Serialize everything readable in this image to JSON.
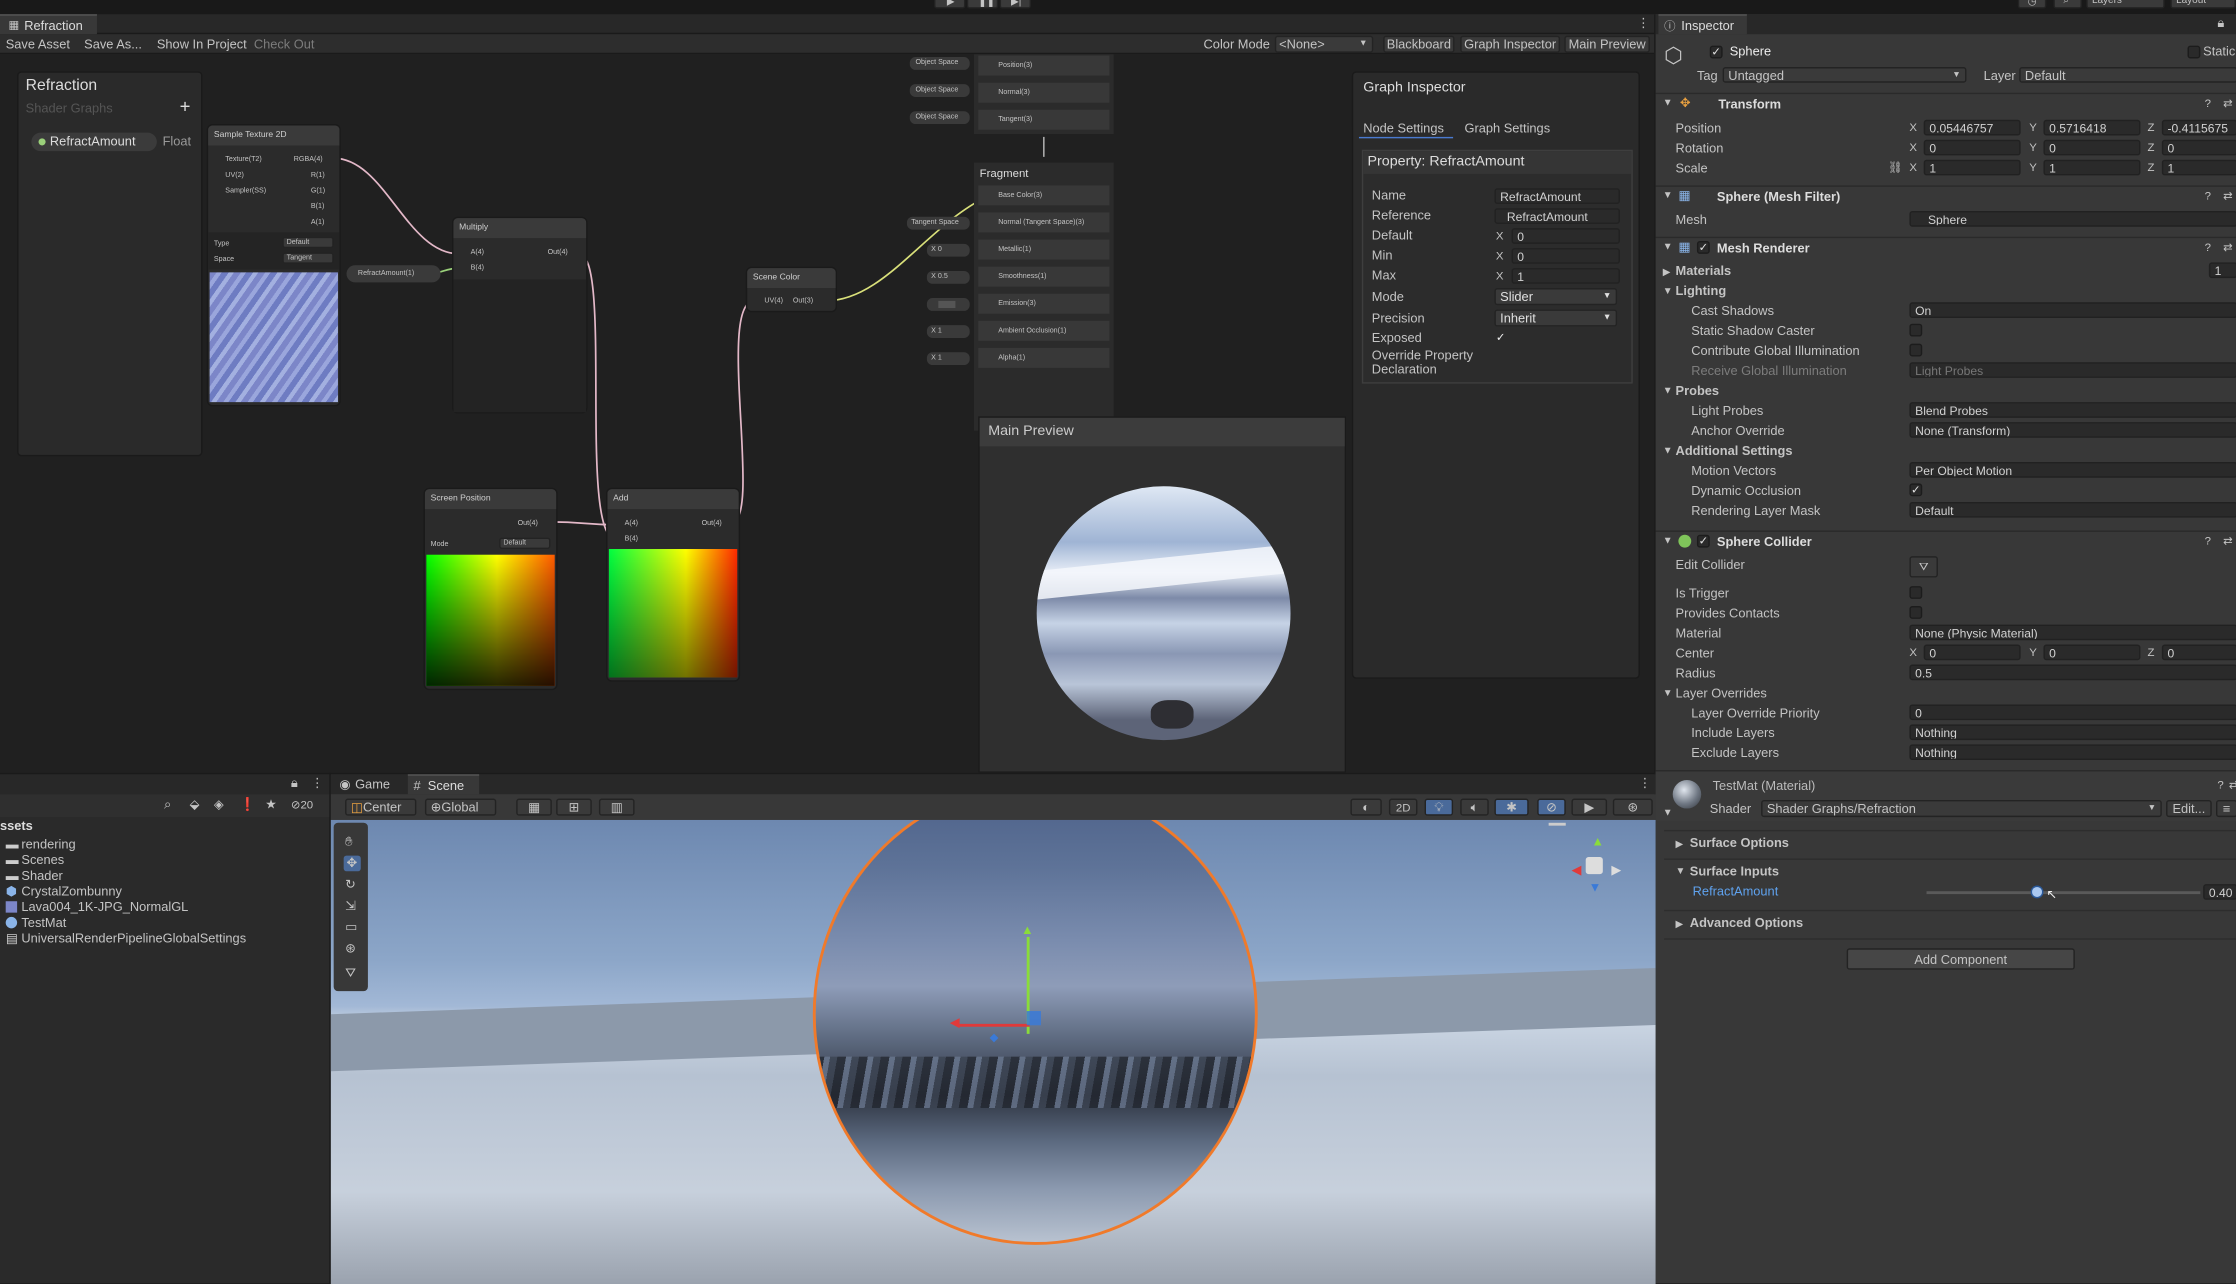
{
  "shader_graph": {
    "window_title": "Refraction",
    "toolbar": {
      "save_asset": "Save Asset",
      "save_as": "Save As...",
      "show_in_project": "Show In Project",
      "check_out": "Check Out",
      "color_mode_label": "Color Mode",
      "color_mode_value": "<None>",
      "blackboard": "Blackboard",
      "graph_inspector": "Graph Inspector",
      "main_preview": "Main Preview"
    },
    "blackboard": {
      "title": "Refraction",
      "subtitle": "Shader Graphs",
      "property_name": "RefractAmount",
      "property_type": "Float"
    },
    "nodes": {
      "sample_texture": {
        "title": "Sample Texture 2D",
        "in_texture": "Texture(T2)",
        "in_uv": "UV(2)",
        "in_sampler": "Sampler(SS)",
        "out_rgba": "RGBA(4)",
        "out_r": "R(1)",
        "out_g": "G(1)",
        "out_b": "B(1)",
        "out_a": "A(1)",
        "type_label": "Type",
        "type_value": "Default",
        "space_label": "Space",
        "space_value": "Tangent"
      },
      "refract_prop": {
        "label": "RefractAmount(1)"
      },
      "multiply": {
        "title": "Multiply",
        "in_a": "A(4)",
        "in_b": "B(4)",
        "out": "Out(4)"
      },
      "scene_color": {
        "title": "Scene Color",
        "in_uv": "UV(4)",
        "out": "Out(3)"
      },
      "screen_position": {
        "title": "Screen Position",
        "out": "Out(4)",
        "mode_label": "Mode",
        "mode_value": "Default"
      },
      "add": {
        "title": "Add",
        "in_a": "A(4)",
        "in_b": "B(4)",
        "out": "Out(4)"
      },
      "vertex": {
        "pos_space": "Object Space",
        "norm_space": "Object Space",
        "tan_space": "Object Space",
        "position": "Position(3)",
        "normal": "Normal(3)",
        "tangent": "Tangent(3)"
      },
      "fragment": {
        "title": "Fragment",
        "base_color": "Base Color(3)",
        "normal": "Normal (Tangent Space)(3)",
        "normal_space": "Tangent Space",
        "metallic": "Metallic(1)",
        "metallic_val": "0",
        "smoothness": "Smoothness(1)",
        "smoothness_val": "0.5",
        "emission": "Emission(3)",
        "ao": "Ambient Occlusion(1)",
        "ao_val": "1",
        "alpha": "Alpha(1)",
        "alpha_val": "1",
        "x": "X"
      }
    },
    "graph_inspector": {
      "title": "Graph Inspector",
      "tab_node": "Node Settings",
      "tab_graph": "Graph Settings",
      "property_header": "Property: RefractAmount",
      "fields": [
        {
          "label": "Name",
          "value": "RefractAmount"
        },
        {
          "label": "Reference",
          "value": "_RefractAmount"
        },
        {
          "label": "Default",
          "value": "0",
          "prefix": "X"
        },
        {
          "label": "Min",
          "value": "0",
          "prefix": "X"
        },
        {
          "label": "Max",
          "value": "1",
          "prefix": "X"
        },
        {
          "label": "Mode",
          "value": "Slider"
        },
        {
          "label": "Precision",
          "value": "Inherit"
        },
        {
          "label": "Exposed",
          "value": "✓"
        }
      ],
      "override_label": "Override Property Declaration"
    },
    "main_preview": {
      "title": "Main Preview"
    }
  },
  "inspector": {
    "tab": "Inspector",
    "object_name": "Sphere",
    "static_label": "Static",
    "tag_label": "Tag",
    "tag_value": "Untagged",
    "layer_label": "Layer",
    "layer_value": "Default",
    "transform": {
      "title": "Transform",
      "position_label": "Position",
      "pos_x": "0.05446757",
      "pos_y": "0.5716418",
      "pos_z": "-0.4115675",
      "rotation_label": "Rotation",
      "rot_x": "0",
      "rot_y": "0",
      "rot_z": "0",
      "scale_label": "Scale",
      "scale_x": "1",
      "scale_y": "1",
      "scale_z": "1"
    },
    "mesh_filter": {
      "title": "Sphere (Mesh Filter)",
      "mesh_label": "Mesh",
      "mesh_value": "Sphere"
    },
    "mesh_renderer": {
      "title": "Mesh Renderer",
      "materials": "Materials",
      "materials_count": "1",
      "lighting": "Lighting",
      "cast_shadows": "Cast Shadows",
      "cast_shadows_val": "On",
      "static_shadow": "Static Shadow Caster",
      "contribute_gi": "Contribute Global Illumination",
      "receive_gi": "Receive Global Illumination",
      "receive_gi_val": "Light Probes",
      "probes": "Probes",
      "light_probes": "Light Probes",
      "light_probes_val": "Blend Probes",
      "anchor": "Anchor Override",
      "anchor_val": "None (Transform)",
      "additional": "Additional Settings",
      "motion": "Motion Vectors",
      "motion_val": "Per Object Motion",
      "dynamic_occ": "Dynamic Occlusion",
      "rendering_mask": "Rendering Layer Mask",
      "rendering_mask_val": "Default"
    },
    "sphere_collider": {
      "title": "Sphere Collider",
      "edit_collider": "Edit Collider",
      "is_trigger": "Is Trigger",
      "provides_contacts": "Provides Contacts",
      "material": "Material",
      "material_val": "None (Physic Material)",
      "center": "Center",
      "c_x": "0",
      "c_y": "0",
      "c_z": "0",
      "radius": "Radius",
      "radius_val": "0.5",
      "layer_overrides": "Layer Overrides",
      "priority": "Layer Override Priority",
      "priority_val": "0",
      "include": "Include Layers",
      "include_val": "Nothing",
      "exclude": "Exclude Layers",
      "exclude_val": "Nothing"
    },
    "material": {
      "name": "TestMat (Material)",
      "shader_label": "Shader",
      "shader_value": "Shader Graphs/Refraction",
      "edit": "Edit...",
      "surface_options": "Surface Options",
      "surface_inputs": "Surface Inputs",
      "refract_label": "RefractAmount",
      "refract_value": "0.40",
      "refract_fraction": 0.4,
      "advanced": "Advanced Options"
    },
    "add_component": "Add Component"
  },
  "project": {
    "header": "ssets",
    "count": "20",
    "items": [
      "rendering",
      "Scenes",
      "Shader",
      "CrystalZombunny",
      "Lava004_1K-JPG_NormalGL",
      "TestMat",
      "UniversalRenderPipelineGlobalSettings"
    ]
  },
  "scene_view": {
    "tab_game": "Game",
    "tab_scene": "Scene",
    "pivot": "Center",
    "space": "Global",
    "mode_2d": "2D"
  },
  "top": {
    "layers": "Layers",
    "layout": "Layout"
  }
}
